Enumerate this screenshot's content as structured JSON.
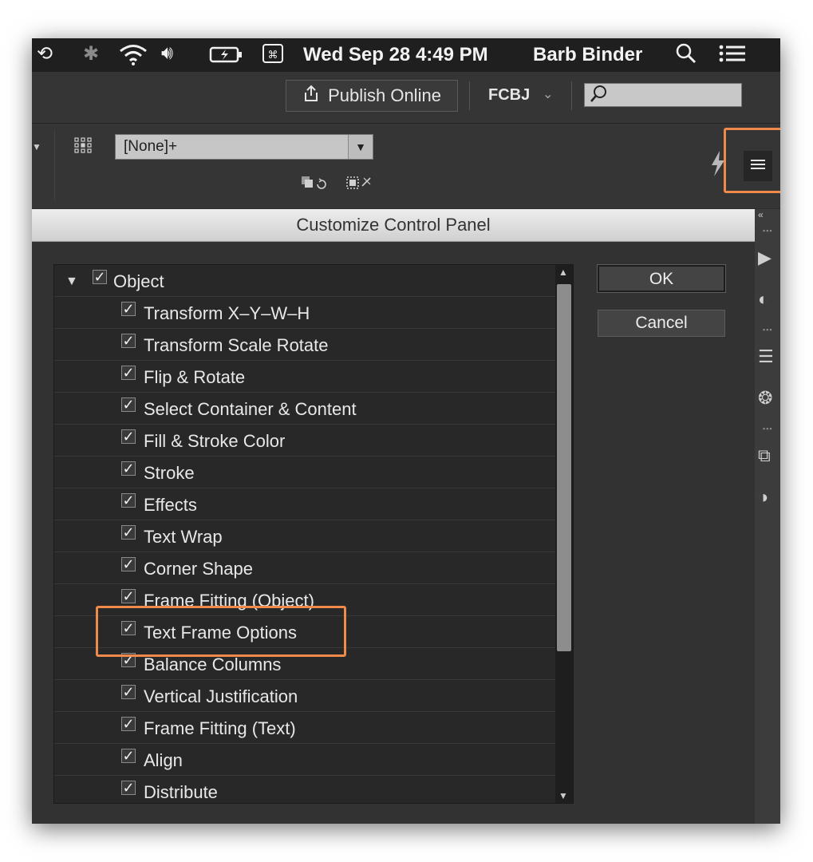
{
  "menubar": {
    "clock": "Wed Sep 28  4:49 PM",
    "user": "Barb Binder",
    "icons": [
      "time-machine-icon",
      "bluetooth-icon",
      "wifi-icon",
      "volume-icon",
      "battery-icon",
      "input-menu-icon",
      "spotlight-icon",
      "notification-center-icon"
    ]
  },
  "toolbar": {
    "publish_label": "Publish Online",
    "workspace": "FCBJ",
    "search_placeholder": ""
  },
  "control_panel": {
    "style_value": "[None]+"
  },
  "dialog": {
    "title": "Customize Control Panel",
    "ok_label": "OK",
    "cancel_label": "Cancel",
    "group": {
      "label": "Object",
      "checked": true,
      "expanded": true
    },
    "items": [
      {
        "label": "Transform X–Y–W–H",
        "checked": true
      },
      {
        "label": "Transform Scale Rotate",
        "checked": true
      },
      {
        "label": "Flip & Rotate",
        "checked": true
      },
      {
        "label": "Select Container & Content",
        "checked": true
      },
      {
        "label": "Fill & Stroke Color",
        "checked": true
      },
      {
        "label": "Stroke",
        "checked": true
      },
      {
        "label": "Effects",
        "checked": true
      },
      {
        "label": "Text Wrap",
        "checked": true
      },
      {
        "label": "Corner Shape",
        "checked": true
      },
      {
        "label": "Frame Fitting (Object)",
        "checked": true
      },
      {
        "label": "Text Frame Options",
        "checked": true
      },
      {
        "label": "Balance Columns",
        "checked": true
      },
      {
        "label": "Vertical Justification",
        "checked": true
      },
      {
        "label": "Frame Fitting (Text)",
        "checked": true
      },
      {
        "label": "Align",
        "checked": true
      },
      {
        "label": "Distribute",
        "checked": true
      }
    ]
  },
  "highlight_color": "#f08a4b"
}
